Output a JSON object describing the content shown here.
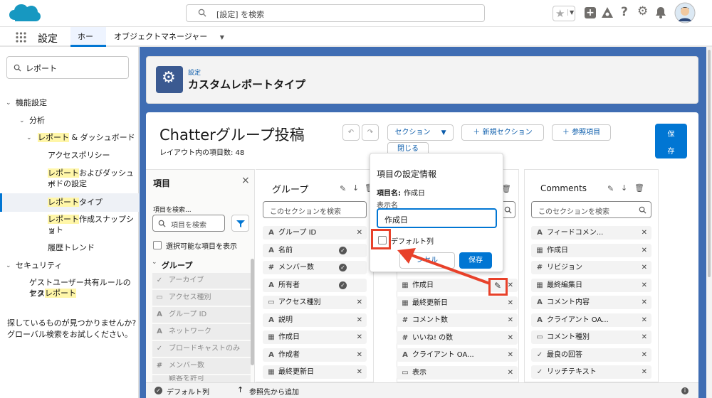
{
  "header": {
    "search_placeholder": "[設定] を検索"
  },
  "nav": {
    "app_title": "設定",
    "tabs": [
      {
        "label": "ホーム"
      },
      {
        "label": "オブジェクトマネージャー"
      }
    ]
  },
  "sidebar": {
    "search_value": "レポート",
    "items": [
      {
        "label": "機能設定"
      },
      {
        "label": "分析"
      },
      {
        "pre": "レポート",
        "post": " & ダッシュボード"
      },
      {
        "label": "アクセスポリシー"
      },
      {
        "pre": "レポート",
        "post": "およびダッシュボ"
      },
      {
        "label": "ードの設定"
      },
      {
        "pre": "レポート",
        "post": "タイプ"
      },
      {
        "pre": "レポート",
        "post": "作成スナップショ"
      },
      {
        "label": "ット"
      },
      {
        "label": "履歴トレンド"
      },
      {
        "label": "セキュリティ"
      },
      {
        "label": "ゲストユーザー共有ルールのアク"
      },
      {
        "pre": "セス",
        "hl": "レポート"
      }
    ],
    "help_line1": "探しているものが見つかりませんか?",
    "help_line2": "グローバル検索をお試しください。"
  },
  "page_header": {
    "breadcrumb": "設定",
    "title": "カスタムレポートタイプ"
  },
  "layout": {
    "title": "Chatterグループ投稿",
    "field_count_label": "レイアウト内の項目数: 48",
    "section_button": "セクション",
    "new_section_button": "新規セクション",
    "lookup_button": "参照項目",
    "close_button": "閉じる",
    "save_line1": "保",
    "save_line2": "存"
  },
  "field_panel": {
    "title": "項目",
    "search_label": "項目を検索...",
    "search_placeholder": "項目を検索",
    "show_selectable": "選択可能な項目を表示",
    "group_label": "グループ",
    "items": [
      {
        "glyph": "✓",
        "label": "アーカイブ"
      },
      {
        "glyph": "▭",
        "label": "アクセス種別"
      },
      {
        "glyph": "A",
        "label": "グループ ID"
      },
      {
        "glyph": "A",
        "label": "ネットワーク"
      },
      {
        "glyph": "✓",
        "label": "ブロードキャストのみ"
      },
      {
        "glyph": "#",
        "label": "メンバー数"
      },
      {
        "glyph": "",
        "label": "顧客を許可"
      }
    ]
  },
  "sections": [
    {
      "title": "グループ",
      "search_placeholder": "このセクションを検索",
      "fields": [
        {
          "glyph": "A",
          "label": "グループ ID",
          "check": false
        },
        {
          "glyph": "A",
          "label": "名前",
          "check": true
        },
        {
          "glyph": "#",
          "label": "メンバー数",
          "check": true
        },
        {
          "glyph": "A",
          "label": "所有者",
          "check": true
        },
        {
          "glyph": "▭",
          "label": "アクセス種別",
          "check": false
        },
        {
          "glyph": "A",
          "label": "説明",
          "check": false
        },
        {
          "glyph": "▦",
          "label": "作成日",
          "check": false
        },
        {
          "glyph": "A",
          "label": "作成者",
          "check": false
        },
        {
          "glyph": "▦",
          "label": "最終更新日",
          "check": false
        }
      ]
    },
    {
      "title": "",
      "search_placeholder": "",
      "fields": [
        {
          "glyph": "▦",
          "label": "作成日"
        },
        {
          "glyph": "▦",
          "label": "最終更新日"
        },
        {
          "glyph": "#",
          "label": "コメント数"
        },
        {
          "glyph": "#",
          "label": "いいね! の数"
        },
        {
          "glyph": "A",
          "label": "クライアント OA..."
        },
        {
          "glyph": "▭",
          "label": "表示"
        }
      ]
    },
    {
      "title": "Comments",
      "search_placeholder": "このセクションを検索",
      "fields": [
        {
          "glyph": "A",
          "label": "フィードコメン..."
        },
        {
          "glyph": "▦",
          "label": "作成日"
        },
        {
          "glyph": "#",
          "label": "リビジョン"
        },
        {
          "glyph": "▦",
          "label": "最終編集日"
        },
        {
          "glyph": "A",
          "label": "コメント内容"
        },
        {
          "glyph": "A",
          "label": "クライアント OA..."
        },
        {
          "glyph": "▭",
          "label": "コメント種別"
        },
        {
          "glyph": "✓",
          "label": "最良の回答"
        },
        {
          "glyph": "✓",
          "label": "リッチテキスト"
        }
      ]
    }
  ],
  "popup": {
    "title": "項目の設定情報",
    "field_name_label": "項目名:",
    "field_name_value": "作成日",
    "display_name_label": "表示名",
    "display_name_value": "作成日",
    "default_column_label": "デフォルト列",
    "cancel_button": "ンセル",
    "save_button": "保存"
  },
  "bottom_bar": {
    "default_column": "デフォルト列",
    "add_from_reference": "参照先から追加"
  },
  "colors": {
    "accent": "#0176d3",
    "highlight_box": "#e8412a",
    "main_bg": "#3f6db3"
  }
}
